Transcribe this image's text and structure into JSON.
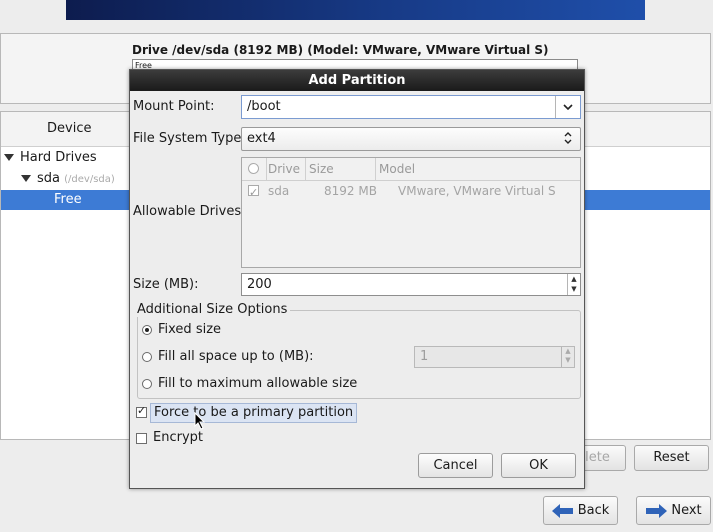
{
  "drive": {
    "title": "Drive /dev/sda (8192 MB) (Model: VMware, VMware Virtual S)",
    "bar_label": "Free"
  },
  "tree": {
    "column_device": "Device",
    "rows": [
      {
        "label": "Hard Drives",
        "sub": ""
      },
      {
        "label": "sda",
        "sub": "(/dev/sda)"
      },
      {
        "label": "Free",
        "sub": ""
      }
    ]
  },
  "background_buttons": {
    "delete_label": "lete",
    "reset_label": "Reset",
    "back_label": "Back",
    "next_label": "Next"
  },
  "dialog": {
    "title": "Add Partition",
    "mount_point_label": "Mount Point:",
    "mount_point_value": "/boot",
    "fs_type_label": "File System Type:",
    "fs_type_value": "ext4",
    "allowable_drives_label": "Allowable Drives:",
    "drives_columns": [
      "Drive",
      "Size",
      "Model"
    ],
    "drives_rows": [
      {
        "checked": true,
        "drive": "sda",
        "size": "8192 MB",
        "model": "VMware, VMware Virtual S"
      }
    ],
    "size_label": "Size (MB):",
    "size_value": "200",
    "additional_title": "Additional Size Options",
    "options": [
      {
        "label": "Fixed size",
        "selected": true
      },
      {
        "label": "Fill all space up to (MB):",
        "selected": false
      },
      {
        "label": "Fill to maximum allowable size",
        "selected": false
      }
    ],
    "fill_up_to_value": "1",
    "force_primary_label": "Force to be a primary partition",
    "force_primary_checked": true,
    "encrypt_label": "Encrypt",
    "encrypt_checked": false,
    "cancel_label": "Cancel",
    "ok_label": "OK"
  },
  "colors": {
    "selection": "#3d7bd5",
    "title_bar": "#2a2a2a",
    "banner": "#173a86"
  }
}
